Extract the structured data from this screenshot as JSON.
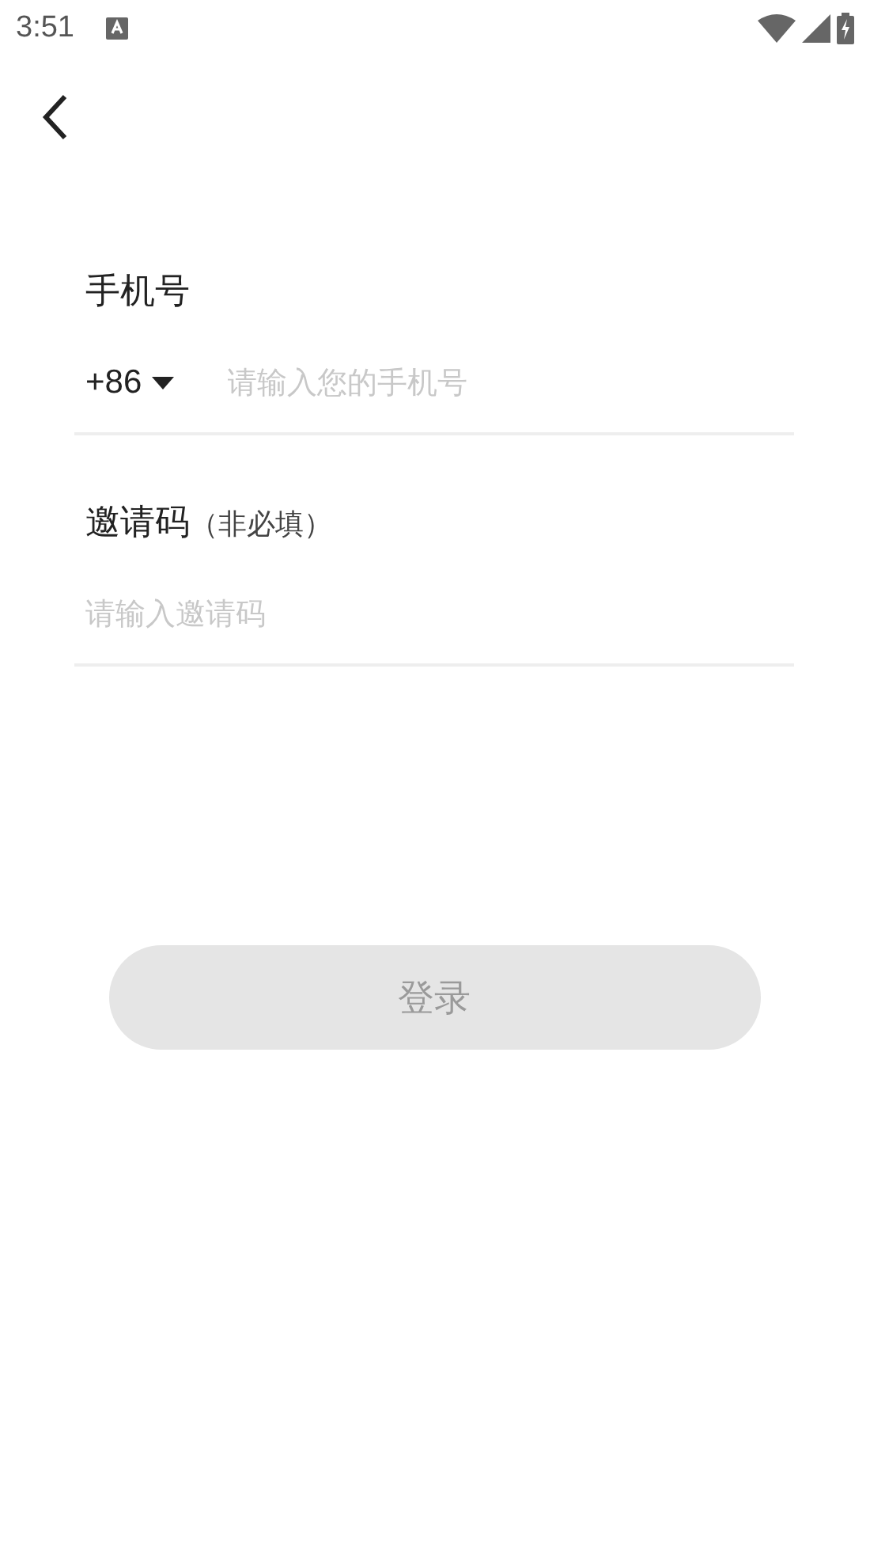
{
  "status_bar": {
    "time": "3:51"
  },
  "phone": {
    "label": "手机号",
    "country_code": "+86",
    "placeholder": "请输入您的手机号"
  },
  "invite": {
    "label": "邀请码",
    "hint": "（非必填）",
    "placeholder": "请输入邀请码"
  },
  "login_button": {
    "label": "登录",
    "disabled": true
  }
}
